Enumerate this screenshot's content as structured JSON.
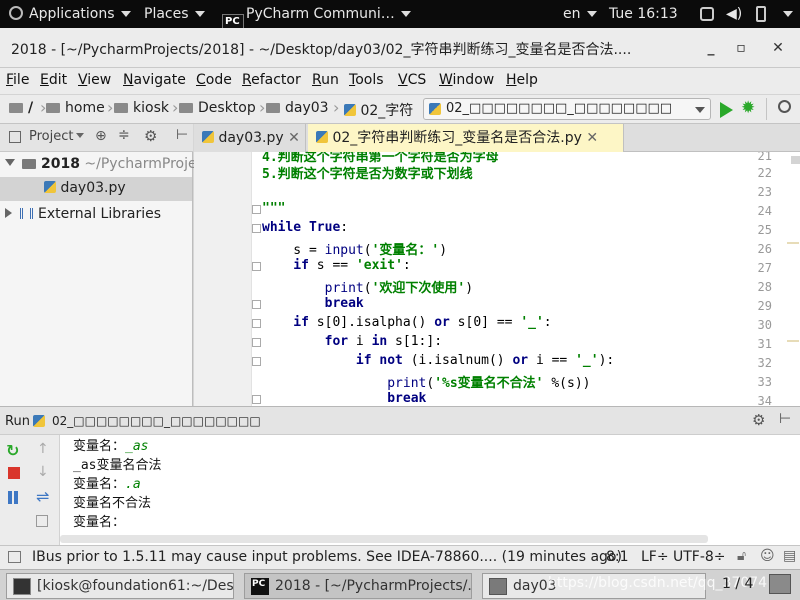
{
  "topbar": {
    "applications": "Applications",
    "places": "Places",
    "app_name": "PyCharm Communi…",
    "lang": "en",
    "clock": "Tue 16:13"
  },
  "window": {
    "title": "2018 - [~/PycharmProjects/2018] - ~/Desktop/day03/02_字符串判断练习_变量名是否合法...."
  },
  "menu": [
    "File",
    "Edit",
    "View",
    "Navigate",
    "Code",
    "Refactor",
    "Run",
    "Tools",
    "VCS",
    "Window",
    "Help"
  ],
  "nav": {
    "crumbs": [
      "/",
      "home",
      "kiosk",
      "Desktop",
      "day03",
      "02_字符"
    ],
    "run_config": "02_□□□□□□□□_□□□□□□□□"
  },
  "project": {
    "header": "Project",
    "root_name": "2018",
    "root_path": "~/PycharmProje",
    "file": "day03.py",
    "external": "External Libraries"
  },
  "tabs": [
    "day03.py",
    "02_字符串判断练习_变量名是否合法.py"
  ],
  "code": {
    "line_numbers": [
      "21",
      "22",
      "23",
      "24",
      "25",
      "26",
      "27",
      "28",
      "29",
      "30",
      "31",
      "32",
      "33",
      "34"
    ],
    "l21": "4.判断这个字符串第一个字符是否为字母",
    "l22": "5.判断这个字符是否为数字或下划线",
    "l24": "\"\"\"",
    "l25_kw": "while",
    "l25_true": "True",
    "l25_rest": ":",
    "l26_a": "    s = ",
    "l26_fn": "input",
    "l26_b": "(",
    "l26_str": "'变量名：'",
    "l26_c": ")",
    "l27_kw": "    if",
    "l27_a": " s == ",
    "l27_str": "'exit'",
    "l27_b": ":",
    "l28_fn": "        print",
    "l28_a": "(",
    "l28_str": "'欢迎下次使用'",
    "l28_b": ")",
    "l29_kw": "        break",
    "l30_kw": "    if",
    "l30_a": " s[0].isalpha() ",
    "l30_or": "or",
    "l30_b": " s[0] == ",
    "l30_str": "'_'",
    "l30_c": ":",
    "l31_kw": "        for",
    "l31_a": " i ",
    "l31_in": "in",
    "l31_b": " s[1:]:",
    "l32_kw": "            if not",
    "l32_a": " (i.isalnum() ",
    "l32_or": "or",
    "l32_b": " i == ",
    "l32_str": "'_'",
    "l32_c": "):",
    "l33_fn": "                print",
    "l33_a": "(",
    "l33_str": "'%s变量名不合法'",
    "l33_b": " %(s))",
    "l34_kw": "                break"
  },
  "run": {
    "label": "Run",
    "config": "02_□□□□□□□□_□□□□□□□□",
    "output": [
      {
        "prompt": "变量名：",
        "input": "_as"
      },
      {
        "text": "_as变量名合法"
      },
      {
        "prompt": "变量名：",
        "input": ".a"
      },
      {
        "text": "变量名不合法"
      },
      {
        "prompt": "变量名：",
        "input": ""
      }
    ]
  },
  "status": {
    "message": "IBus prior to 1.5.11 may cause input problems. See IDEA-78860.... (19 minutes ago)",
    "position": "8:1",
    "line_sep": "LF÷",
    "encoding": "UTF-8÷"
  },
  "taskbar": {
    "items": [
      "[kiosk@foundation61:~/Desk...",
      "2018 - [~/PycharmProjects/...",
      "day03"
    ],
    "watermark": "https://blog.csdn.net/qq_37074",
    "pager": "1 / 4"
  },
  "colors": {
    "keyword": "#000080",
    "string": "#008000",
    "run_green": "#2aa82a",
    "stop_red": "#d9352b"
  }
}
